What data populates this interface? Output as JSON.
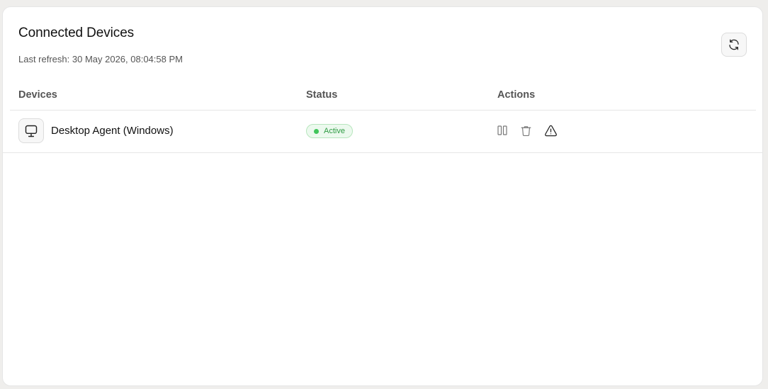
{
  "header": {
    "title": "Connected Devices",
    "last_refresh": "Last refresh: 30 May 2026, 08:04:58 PM",
    "refresh_icon": "refresh-icon"
  },
  "table": {
    "columns": [
      "Devices",
      "Status",
      "Actions"
    ],
    "rows": [
      {
        "icon": "monitor-icon",
        "name": "Desktop Agent (Windows)",
        "status": "Active",
        "actions": [
          "pause-icon",
          "trash-icon",
          "warning-icon"
        ]
      }
    ]
  },
  "colors": {
    "status_active_text": "#2e9b43",
    "status_active_dot": "#3fc55a",
    "status_active_bg": "#ecf9ee"
  }
}
